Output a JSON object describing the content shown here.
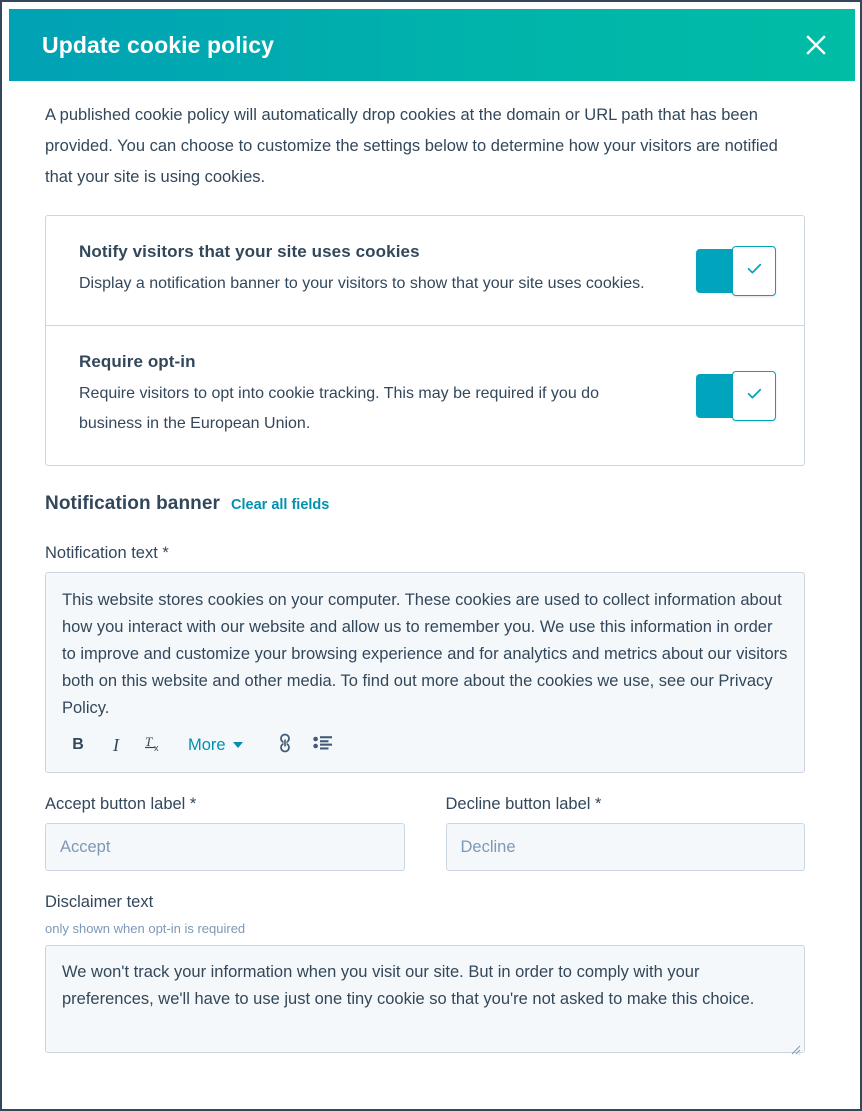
{
  "modal": {
    "title": "Update cookie policy",
    "close_label": "Close",
    "intro": "A published cookie policy will automatically drop cookies at the domain or URL path that has been provided. You can choose to customize the settings below to determine how your visitors are notified that your site is using cookies."
  },
  "settings": [
    {
      "title": "Notify visitors that your site uses cookies",
      "description": "Display a notification banner to your visitors to show that your site uses cookies.",
      "toggle_state": "on"
    },
    {
      "title": "Require opt-in",
      "description": "Require visitors to opt into cookie tracking. This may be required if you do business in the European Union.",
      "toggle_state": "on"
    }
  ],
  "banner_section": {
    "title": "Notification banner",
    "clear_link": "Clear all fields"
  },
  "notification_field": {
    "label": "Notification text *",
    "value": "This website stores cookies on your computer. These cookies are used to collect information about how you interact with our website and allow us to remember you. We use this information in order to improve and customize your browsing experience and for analytics and metrics about our visitors both on this website and other media. To find out more about the cookies we use, see our Privacy Policy."
  },
  "toolbar": {
    "bold_label": "B",
    "italic_label": "I",
    "clear_format_label": "Tx",
    "more_label": "More",
    "link_icon_name": "link-icon",
    "list_icon_name": "bulleted-list-icon"
  },
  "accept_field": {
    "label": "Accept button label *",
    "placeholder": "Accept",
    "value": ""
  },
  "decline_field": {
    "label": "Decline button label *",
    "placeholder": "Decline",
    "value": ""
  },
  "disclaimer_field": {
    "label": "Disclaimer text",
    "sublabel": "only shown when opt-in is required",
    "value": "We won't track your information when you visit our site. But in order to comply with your preferences, we'll have to use just one tiny cookie so that you're not asked to make this choice."
  },
  "colors": {
    "header_gradient_start": "#00a1b5",
    "header_gradient_end": "#00bda5",
    "accent": "#00a4bd",
    "link": "#0091ae",
    "text": "#33475b",
    "muted_text": "#7c98b6",
    "field_bg": "#f5f8fa",
    "border": "#cbd6e2"
  }
}
